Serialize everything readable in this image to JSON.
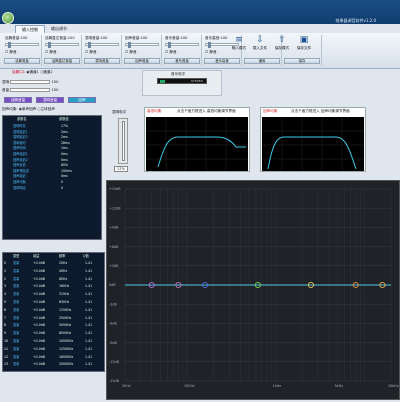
{
  "app": {
    "title": "效果器调音软件v1.2.0"
  },
  "tabs": [
    {
      "label": "输入控制"
    },
    {
      "label": "输出调节"
    }
  ],
  "ribbon": {
    "groups": [
      {
        "label": "话筒音量:100",
        "mute": "静音",
        "button": "话筒音量"
      },
      {
        "label": "话筒直达音量:100",
        "mute": "静音",
        "button": "话筒直达音量"
      },
      {
        "label": "混响音量:100",
        "mute": "静音",
        "button": "混响音量"
      },
      {
        "label": "回声音量:100",
        "mute": "静音",
        "button": "回声音量"
      },
      {
        "label": "音乐音量:100",
        "mute": "静音",
        "button": "音乐音量"
      },
      {
        "label": "音乐高音:100",
        "mute": "静音",
        "button": "音乐高音"
      },
      {
        "label": "",
        "mute": "",
        "button": "通用"
      },
      {
        "label": "",
        "mute": "",
        "button": "保存"
      }
    ],
    "big_buttons": [
      {
        "label": "输入模式",
        "icon": "≡"
      },
      {
        "label": "载入文件",
        "icon": "⇩"
      },
      {
        "label": "保存模式",
        "icon": "⇧"
      },
      {
        "label": "保存文件",
        "icon": "▣"
      }
    ]
  },
  "left": {
    "mic_label": "话筒口1",
    "mic_ch1": "通道1",
    "mic_ch2": "通道2",
    "reverb_label": "混响",
    "reverb_value": "100",
    "volume_label": "音量",
    "volume_value": "100",
    "mic2_label": "话筒口2",
    "mic2_ch1": "通道1",
    "mic2_ch2": "通道2",
    "reverb2_value": "100",
    "volume2_value": "100",
    "btn_mic": "话筒音量",
    "btn_reverb": "混响音量",
    "btn_echo": "回声",
    "mode_label": "回声均衡:",
    "mode_opt1": "单声回声",
    "mode_opt2": "立体回声",
    "param_headers": [
      "参数名",
      "参数值"
    ],
    "params": [
      [
        "混响时长",
        "17%"
      ],
      [
        "混响延迟1",
        "2ms"
      ],
      [
        "混响延迟2",
        "2ms"
      ],
      [
        "混响延时",
        "28ms"
      ],
      [
        "回声时间",
        "1ms"
      ],
      [
        "回声延迟1",
        "0ms"
      ],
      [
        "回声延迟2",
        "0ms"
      ],
      [
        "回声反馈",
        "60%"
      ],
      [
        "回声预延迟",
        "100ms"
      ],
      [
        "回声延迟",
        "0ms"
      ],
      [
        "回声均衡",
        "0"
      ],
      [
        "混响响应",
        "0"
      ]
    ],
    "band_headers": [
      "类型",
      "增益",
      "频率",
      "Q值"
    ],
    "bands": [
      [
        "0",
        "变量",
        "+0.0dB",
        "20Hz",
        "1.41"
      ],
      [
        "1",
        "变量",
        "+0.0dB",
        "40Hz",
        "1.41"
      ],
      [
        "2",
        "变量",
        "+0.0dB",
        "80Hz",
        "1.41"
      ],
      [
        "3",
        "变量",
        "+0.0dB",
        "160Hz",
        "1.41"
      ],
      [
        "4",
        "变量",
        "+0.0dB",
        "315Hz",
        "1.41"
      ],
      [
        "5",
        "变量",
        "+0.0dB",
        "630Hz",
        "1.41"
      ],
      [
        "6",
        "变量",
        "+0.0dB",
        "1250Hz",
        "1.41"
      ],
      [
        "7",
        "变量",
        "+0.0dB",
        "2500Hz",
        "1.41"
      ],
      [
        "8",
        "变量",
        "+0.0dB",
        "5000Hz",
        "1.41"
      ],
      [
        "9",
        "变量",
        "+0.0dB",
        "8000Hz",
        "1.41"
      ],
      [
        "10",
        "变量",
        "+0.0dB",
        "10000Hz",
        "1.41"
      ],
      [
        "11",
        "变量",
        "+0.0dB",
        "12500Hz",
        "1.41"
      ],
      [
        "12",
        "变量",
        "+0.0dB",
        "16000Hz",
        "1.41"
      ],
      [
        "13",
        "变量",
        "+0.0dB",
        "20000Hz",
        "1.41"
      ]
    ]
  },
  "mid": {
    "label": "混响电平",
    "value": "17%"
  },
  "vu": {
    "label": "音乐电平",
    "stereo": "STEREO"
  },
  "hpf": {
    "tag": "高低均衡",
    "hint": "点击下面方框进入 高低均衡调节界面"
  },
  "lpf": {
    "tag": "回声均衡",
    "hint": "点击下面方框进入 回声均衡调节界面"
  },
  "eq": {
    "x_ticks": [
      "20Hz",
      "100Hz",
      "1kHz",
      "5kHz",
      "20kHz"
    ],
    "y_ticks": [
      "+15dB",
      "+12dB",
      "+9dB",
      "+6dB",
      "+3dB",
      "0dB",
      "-3dB",
      "-6dB",
      "-9dB",
      "-12dB",
      "-15dB"
    ],
    "points": [
      {
        "freq": "40Hz",
        "color": "#b56dd6"
      },
      {
        "freq": "80Hz",
        "color": "#c070c0"
      },
      {
        "freq": "160Hz",
        "color": "#4f6ae0"
      },
      {
        "freq": "630Hz",
        "color": "#7bd65a"
      },
      {
        "freq": "2500Hz",
        "color": "#e6c84a"
      },
      {
        "freq": "8000Hz",
        "color": "#ea8e3d"
      },
      {
        "freq": "16000Hz",
        "color": "#e8b040"
      }
    ]
  }
}
